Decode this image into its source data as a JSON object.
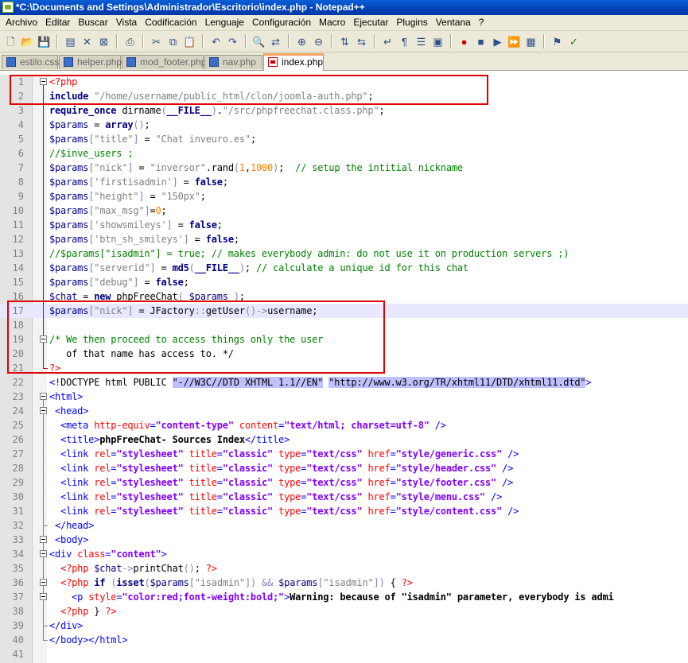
{
  "window": {
    "title": "*C:\\Documents and Settings\\Administrador\\Escritorio\\index.php - Notepad++"
  },
  "menu": [
    "Archivo",
    "Editar",
    "Buscar",
    "Vista",
    "Codificación",
    "Lenguaje",
    "Configuración",
    "Macro",
    "Ejecutar",
    "Plugins",
    "Ventana",
    "?"
  ],
  "toolbar": {
    "icons": [
      "new-file-icon",
      "open-file-icon",
      "save-icon",
      "save-all-icon",
      "close-icon",
      "close-all-icon",
      "print-icon",
      "cut-icon",
      "copy-icon",
      "paste-icon",
      "undo-icon",
      "redo-icon",
      "find-icon",
      "replace-icon",
      "zoom-in-icon",
      "zoom-out-icon",
      "sync-v-icon",
      "sync-h-icon",
      "wrap-icon",
      "all-chars-icon",
      "indent-guide-icon",
      "fold-icon",
      "record-macro-icon",
      "stop-macro-icon",
      "play-macro-icon",
      "run-macro-multiple-icon",
      "save-macro-icon",
      "launch-icon",
      "spellcheck-icon"
    ]
  },
  "tabs": [
    {
      "label": "estilo.css",
      "active": false
    },
    {
      "label": "helper.php",
      "active": false
    },
    {
      "label": "mod_footer.php",
      "active": false
    },
    {
      "label": "nav.php",
      "active": false
    },
    {
      "label": "index.php",
      "active": true
    }
  ],
  "editor": {
    "current_line": 17,
    "lines": [
      "<?php",
      "include \"/home/username/public_html/clon/joomla-auth.php\";",
      "require_once dirname(__FILE__).\"/src/phpfreechat.class.php\";",
      "$params = array();",
      "$params[\"title\"] = \"Chat inveuro.es\";",
      "//$inve_users ;",
      "$params[\"nick\"] = \"inversor\".rand(1,1000);  // setup the intitial nickname",
      "$params['firstisadmin'] = false;",
      "$params[\"height\"] = \"150px\";",
      "$params[\"max_msg\"]=0;",
      "$params['showsmileys'] = false;",
      "$params['btn_sh_smileys'] = false;",
      "//$params[\"isadmin\"] = true; // makes everybody admin: do not use it on production servers ;)",
      "$params[\"serverid\"] = md5(__FILE__); // calculate a unique id for this chat",
      "$params[\"debug\"] = false;",
      "$chat = new phpFreeChat( $params );",
      "$params[\"nick\"] = JFactory::getUser()->username;",
      "",
      "/* We then proceed to access things only the user",
      "   of that name has access to. */",
      "?>",
      "<!DOCTYPE html PUBLIC \"-//W3C//DTD XHTML 1.1//EN\" \"http://www.w3.org/TR/xhtml11/DTD/xhtml11.dtd\">",
      "<html>",
      " <head>",
      "  <meta http-equiv=\"content-type\" content=\"text/html; charset=utf-8\" />",
      "  <title>phpFreeChat- Sources Index</title>",
      "  <link rel=\"stylesheet\" title=\"classic\" type=\"text/css\" href=\"style/generic.css\" />",
      "  <link rel=\"stylesheet\" title=\"classic\" type=\"text/css\" href=\"style/header.css\" />",
      "  <link rel=\"stylesheet\" title=\"classic\" type=\"text/css\" href=\"style/footer.css\" />",
      "  <link rel=\"stylesheet\" title=\"classic\" type=\"text/css\" href=\"style/menu.css\" />",
      "  <link rel=\"stylesheet\" title=\"classic\" type=\"text/css\" href=\"style/content.css\" />",
      " </head>",
      " <body>",
      "<div class=\"content\">",
      "  <?php $chat->printChat(); ?>",
      "  <?php if (isset($params[\"isadmin\"]) && $params[\"isadmin\"]) { ?>",
      "    <p style=\"color:red;font-weight:bold;\">Warning: because of \"isadmin\" parameter, everybody is admi",
      "  <?php } ?>",
      "</div>",
      "</body></html>",
      ""
    ]
  },
  "colors": {
    "annotation_box": "#e00000",
    "current_line": "#e8e8ff"
  }
}
